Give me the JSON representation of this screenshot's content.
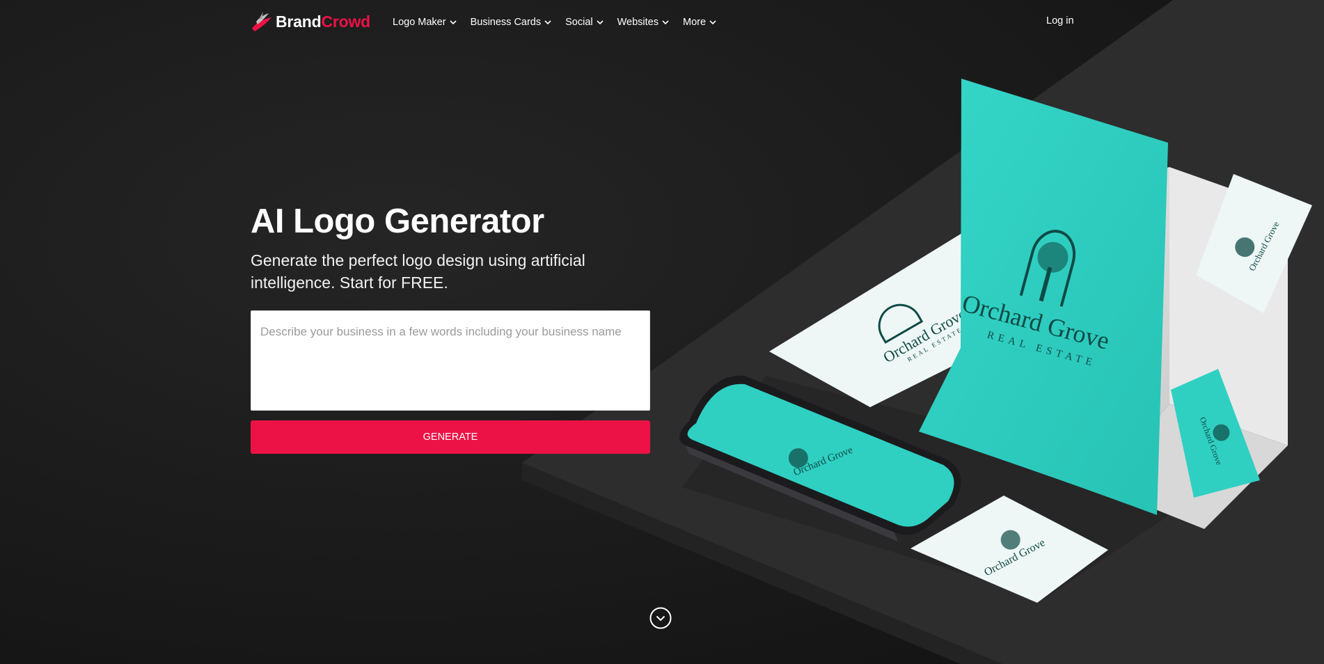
{
  "brand": {
    "part1": "Brand",
    "part2": "Crowd",
    "accent": "#ec1246"
  },
  "nav": {
    "items": [
      {
        "label": "Logo Maker",
        "icon": "chevron-down-icon"
      },
      {
        "label": "Business Cards",
        "icon": "chevron-down-icon"
      },
      {
        "label": "Social",
        "icon": "chevron-down-icon"
      },
      {
        "label": "Websites",
        "icon": "chevron-down-icon"
      },
      {
        "label": "More",
        "icon": "chevron-down-icon"
      }
    ],
    "login": "Log in"
  },
  "hero": {
    "title": "AI Logo Generator",
    "subtitle": "Generate the perfect logo design using artificial intelligence. Start for FREE.",
    "placeholder": "Describe your business in a few words including your business name",
    "value": "",
    "button": "GENERATE"
  },
  "mockup": {
    "brand_name": "Orchard Grove",
    "tagline": "REAL ESTATE",
    "teal": "#2fd0c2",
    "dark_teal": "#0f4a45"
  },
  "icons": {
    "scroll": "chevron-circle-down-icon",
    "logo": "brandcrowd-logo-icon"
  }
}
